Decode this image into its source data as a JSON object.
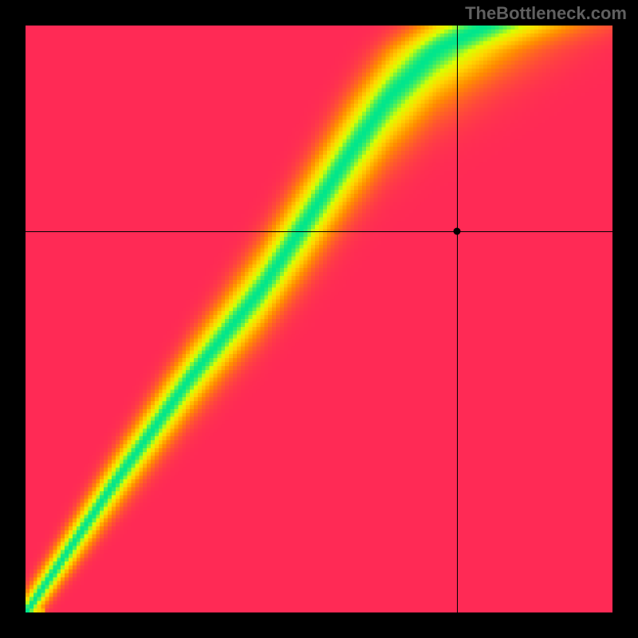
{
  "watermark": "TheBottleneck.com",
  "chart_data": {
    "type": "heatmap",
    "title": "",
    "xlabel": "",
    "ylabel": "",
    "xlim": [
      0,
      100
    ],
    "ylim": [
      0,
      100
    ],
    "crosshair": {
      "x": 73.5,
      "y": 65
    },
    "marker": {
      "x": 73.5,
      "y": 65
    },
    "color_scale": {
      "low": "#ff2a55",
      "mid_low": "#ff8c00",
      "mid": "#ffd700",
      "mid_high": "#d9ff00",
      "high": "#00e68c"
    },
    "ridge": {
      "description": "Curved diagonal band of optimal values from lower-left to upper area",
      "points": [
        {
          "x": 0,
          "y": 0
        },
        {
          "x": 15,
          "y": 22
        },
        {
          "x": 28,
          "y": 40
        },
        {
          "x": 40,
          "y": 55
        },
        {
          "x": 48,
          "y": 67
        },
        {
          "x": 55,
          "y": 78
        },
        {
          "x": 62,
          "y": 88
        },
        {
          "x": 70,
          "y": 96
        },
        {
          "x": 78,
          "y": 100
        }
      ]
    }
  }
}
